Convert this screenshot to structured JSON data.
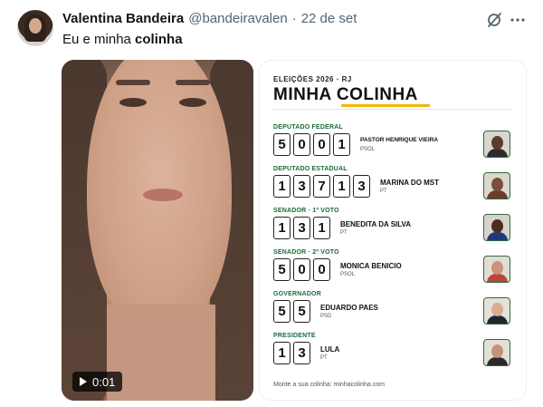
{
  "author": {
    "name": "Valentina Bandeira",
    "handle": "@bandeiravalen",
    "separator": "·",
    "date": "22 de set"
  },
  "tweet": {
    "text_prefix": "Eu e minha ",
    "text_bold": "colinha"
  },
  "video": {
    "duration": "0:01",
    "play_icon": "play-icon"
  },
  "card": {
    "kicker": "ELEIÇÕES 2026 · RJ",
    "title": "MINHA COLINHA",
    "footer": "Monte a sua colinha: minhacolinha.com",
    "accent_color": "#f2b705",
    "office_color": "#1a6b3a",
    "entries": [
      {
        "office": "DEPUTADO FEDERAL",
        "digits": [
          "5",
          "0",
          "0",
          "1"
        ],
        "name": "PASTOR HENRIQUE VIEIRA",
        "party": "PSOL"
      },
      {
        "office": "DEPUTADO ESTADUAL",
        "digits": [
          "1",
          "3",
          "7",
          "1",
          "3"
        ],
        "name": "MARINA DO MST",
        "party": "PT"
      },
      {
        "office": "SENADOR · 1º VOTO",
        "digits": [
          "1",
          "3",
          "1"
        ],
        "name": "BENEDITA DA SILVA",
        "party": "PT"
      },
      {
        "office": "SENADOR · 2º VOTO",
        "digits": [
          "5",
          "0",
          "0"
        ],
        "name": "MONICA BENICIO",
        "party": "PSOL"
      },
      {
        "office": "GOVERNADOR",
        "digits": [
          "5",
          "5"
        ],
        "name": "EDUARDO PAES",
        "party": "PSD"
      },
      {
        "office": "PRESIDENTE",
        "digits": [
          "1",
          "3"
        ],
        "name": "LULA",
        "party": "PT"
      }
    ]
  },
  "icons": {
    "grok": "grok-icon",
    "more": "more-icon"
  }
}
